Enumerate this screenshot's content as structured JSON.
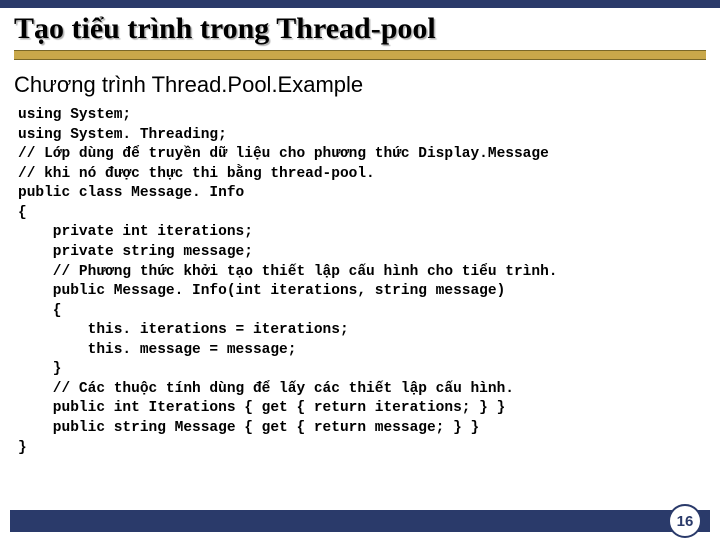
{
  "header": {
    "title": "Tạo tiểu trình trong Thread-pool"
  },
  "subtitle": "Chương trình Thread.Pool.Example",
  "code_lines": [
    "using System;",
    "using System. Threading;",
    "// Lớp dùng để truyền dữ liệu cho phương thức Display.Message",
    "// khi nó được thực thi bằng thread-pool.",
    "public class Message. Info",
    "{",
    "    private int iterations;",
    "    private string message;",
    "    // Phương thức khởi tạo thiết lập cấu hình cho tiểu trình.",
    "    public Message. Info(int iterations, string message)",
    "    {",
    "        this. iterations = iterations;",
    "        this. message = message;",
    "    }",
    "    // Các thuộc tính dùng để lấy các thiết lập cấu hình.",
    "    public int Iterations { get { return iterations; } }",
    "    public string Message { get { return message; } }",
    "}"
  ],
  "page_number": "16"
}
